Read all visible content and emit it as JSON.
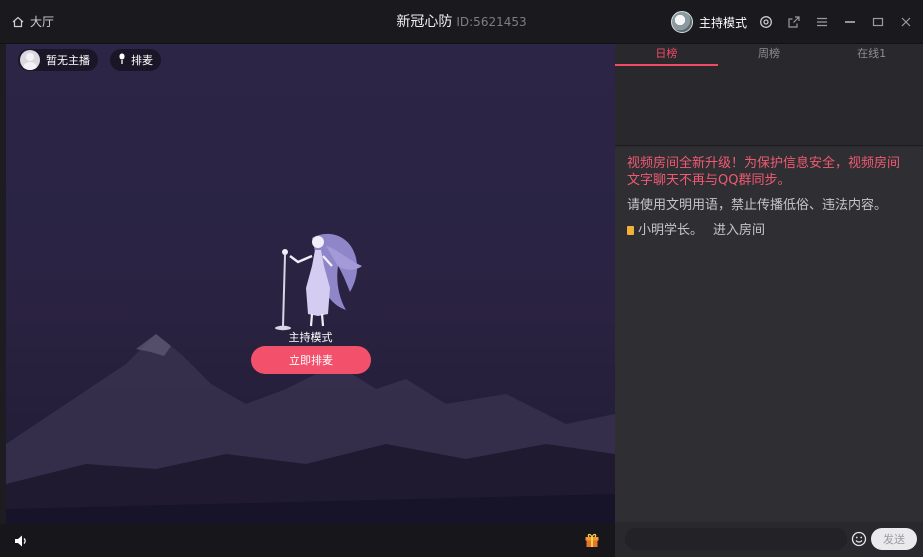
{
  "titlebar": {
    "hall_label": "大厅",
    "room_name": "新冠心防",
    "room_id": "ID:5621453",
    "mode_label": "主持模式",
    "icons": [
      "settings-icon",
      "share-icon",
      "menu-icon",
      "minimize-icon",
      "maximize-icon",
      "close-icon"
    ]
  },
  "stage": {
    "host_label": "暂无主播",
    "queue_label": "排麦",
    "mode_label": "主持模式",
    "join_button": "立即排麦"
  },
  "tabs": [
    {
      "label": "日榜",
      "active": true
    },
    {
      "label": "周榜",
      "active": false
    },
    {
      "label": "在线1",
      "active": false
    }
  ],
  "chat": {
    "notice": "视频房间全新升级！为保护信息安全，视频房间文字聊天不再与QQ群同步。",
    "rule": "请使用文明用语，禁止传播低俗、违法内容。",
    "enter_user": "小明学长。",
    "enter_text": "进入房间"
  },
  "input": {
    "placeholder": "",
    "send_label": "发送"
  },
  "colors": {
    "accent": "#ef4b66",
    "join_button": "#f2506b",
    "stage_bg": "#2a2343"
  }
}
